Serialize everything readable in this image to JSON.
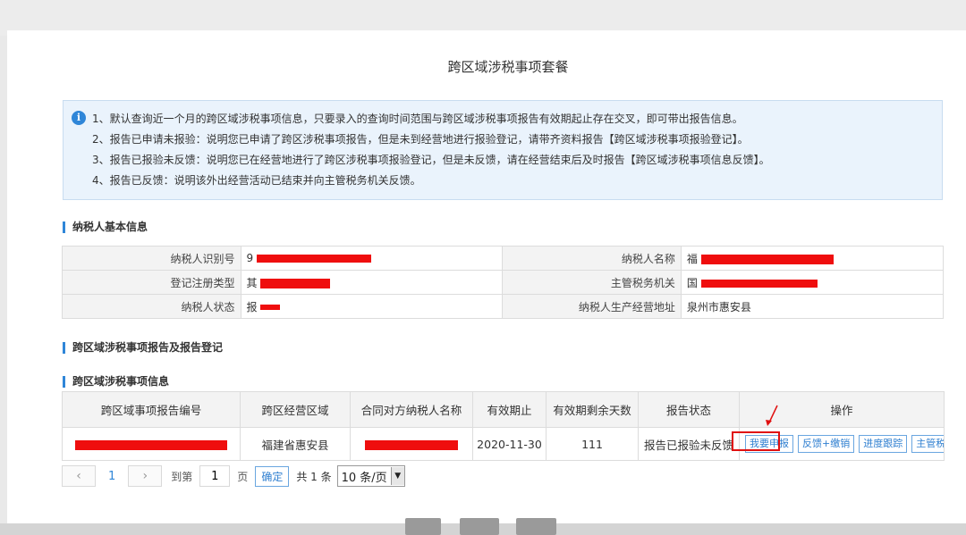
{
  "modal": {
    "title": "跨区域涉税事项套餐"
  },
  "notice": {
    "icon": "info-icon",
    "lines": [
      "1、默认查询近一个月的跨区域涉税事项信息，只要录入的查询时间范围与跨区域涉税事项报告有效期起止存在交叉，即可带出报告信息。",
      "2、报告已申请未报验：说明您已申请了跨区涉税事项报告，但是未到经营地进行报验登记，请带齐资料报告【跨区域涉税事项报验登记】。",
      "3、报告已报验未反馈：说明您已在经营地进行了跨区涉税事项报验登记，但是未反馈，请在经营结束后及时报告【跨区域涉税事项信息反馈】。",
      "4、报告已反馈：说明该外出经营活动已结束并向主管税务机关反馈。"
    ]
  },
  "taxpayer_section": {
    "title": "纳税人基本信息",
    "rows": [
      {
        "label1": "纳税人识别号",
        "value1": "9",
        "label2": "纳税人名称",
        "value2": "福"
      },
      {
        "label1": "登记注册类型",
        "value1": "其",
        "label2": "主管税务机关",
        "value2": "国"
      },
      {
        "label1": "纳税人状态",
        "value1": "报",
        "label2": "纳税人生产经营地址",
        "value2": "泉州市惠安县"
      }
    ]
  },
  "report_section": {
    "title": "跨区域涉税事项报告及报告登记"
  },
  "info_section": {
    "title": "跨区域涉税事项信息",
    "columns": [
      "跨区域事项报告编号",
      "跨区经营区域",
      "合同对方纳税人名称",
      "有效期止",
      "有效期剩余天数",
      "报告状态",
      "操作"
    ],
    "rows": [
      {
        "report_no": "",
        "region": "福建省惠安县",
        "counterparty": "",
        "expire": "2020-11-30",
        "days_left": "111",
        "status": "报告已报验未反馈",
        "actions": [
          "我要申报",
          "反馈+缴销",
          "进度跟踪",
          "主管税"
        ]
      }
    ]
  },
  "pager": {
    "prev_icon": "chevron-left-icon",
    "next_icon": "chevron-right-icon",
    "current_page": "1",
    "goto_label": "到第",
    "goto_value": "1",
    "page_unit": "页",
    "ok_label": "确定",
    "total_label": "共 1 条",
    "page_size": "10 条/页"
  },
  "colors": {
    "accent": "#2f86d8",
    "redaction": "#ef0e0e",
    "highlight": "#e01010"
  }
}
